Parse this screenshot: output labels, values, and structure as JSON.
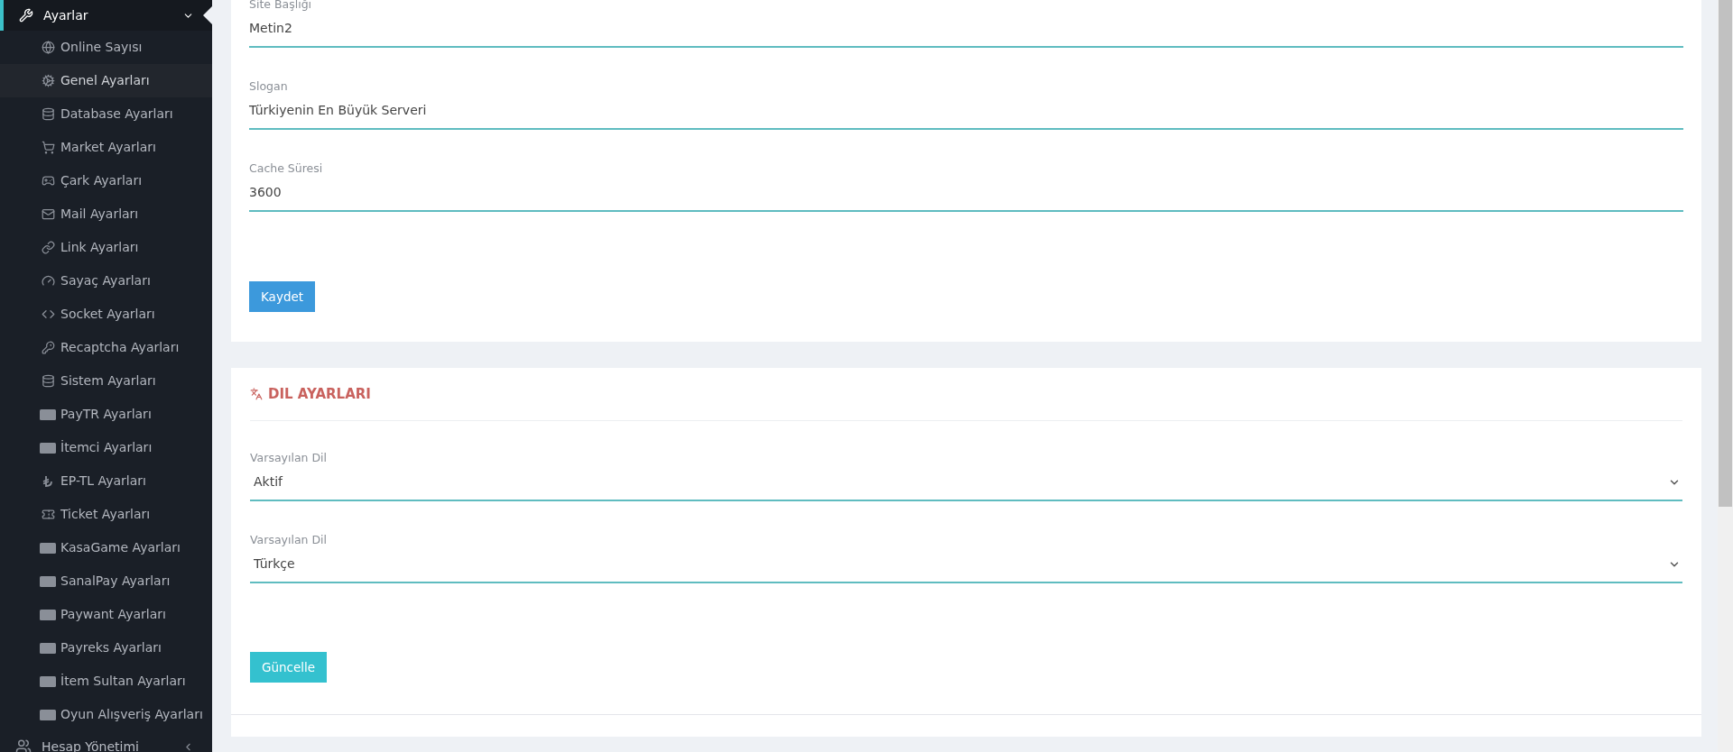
{
  "sidebar": {
    "items": [
      {
        "label": "Ayarlar",
        "selected": true,
        "expanded": true,
        "children": [
          {
            "label": "Online Sayısı",
            "selected": false
          },
          {
            "label": "Genel Ayarları",
            "selected": true
          },
          {
            "label": "Database Ayarları",
            "selected": false
          },
          {
            "label": "Market Ayarları",
            "selected": false
          },
          {
            "label": "Çark Ayarları",
            "selected": false
          },
          {
            "label": "Mail Ayarları",
            "selected": false
          },
          {
            "label": "Link Ayarları",
            "selected": false
          },
          {
            "label": "Sayaç Ayarları",
            "selected": false
          },
          {
            "label": "Socket Ayarları",
            "selected": false
          },
          {
            "label": "Recaptcha Ayarları",
            "selected": false
          },
          {
            "label": "Sistem Ayarları",
            "selected": false
          },
          {
            "label": "PayTR Ayarları",
            "selected": false
          },
          {
            "label": "İtemci Ayarları",
            "selected": false
          },
          {
            "label": "EP-TL Ayarları",
            "selected": false
          },
          {
            "label": "Ticket Ayarları",
            "selected": false
          },
          {
            "label": "KasaGame Ayarları",
            "selected": false
          },
          {
            "label": "SanalPay Ayarları",
            "selected": false
          },
          {
            "label": "Paywant Ayarları",
            "selected": false
          },
          {
            "label": "Payreks Ayarları",
            "selected": false
          },
          {
            "label": "İtem Sultan Ayarları",
            "selected": false
          },
          {
            "label": "Oyun Alışveriş Ayarları",
            "selected": false
          }
        ]
      },
      {
        "label": "Hesap Yönetimi",
        "selected": false,
        "expanded": false
      }
    ]
  },
  "general_card": {
    "fields": [
      {
        "label": "Site Başlığı",
        "value": "Metin2"
      },
      {
        "label": "Slogan",
        "value": "Türkiyenin En Büyük Serveri"
      },
      {
        "label": "Cache Süresi",
        "value": "3600"
      }
    ],
    "button": "Kaydet"
  },
  "language_card": {
    "title": "DIL AYARLARI",
    "selects": [
      {
        "label": "Varsayılan Dil",
        "value": "Aktif"
      },
      {
        "label": "Varsayılan Dil",
        "value": "Türkçe"
      }
    ],
    "button": "Güncelle"
  }
}
